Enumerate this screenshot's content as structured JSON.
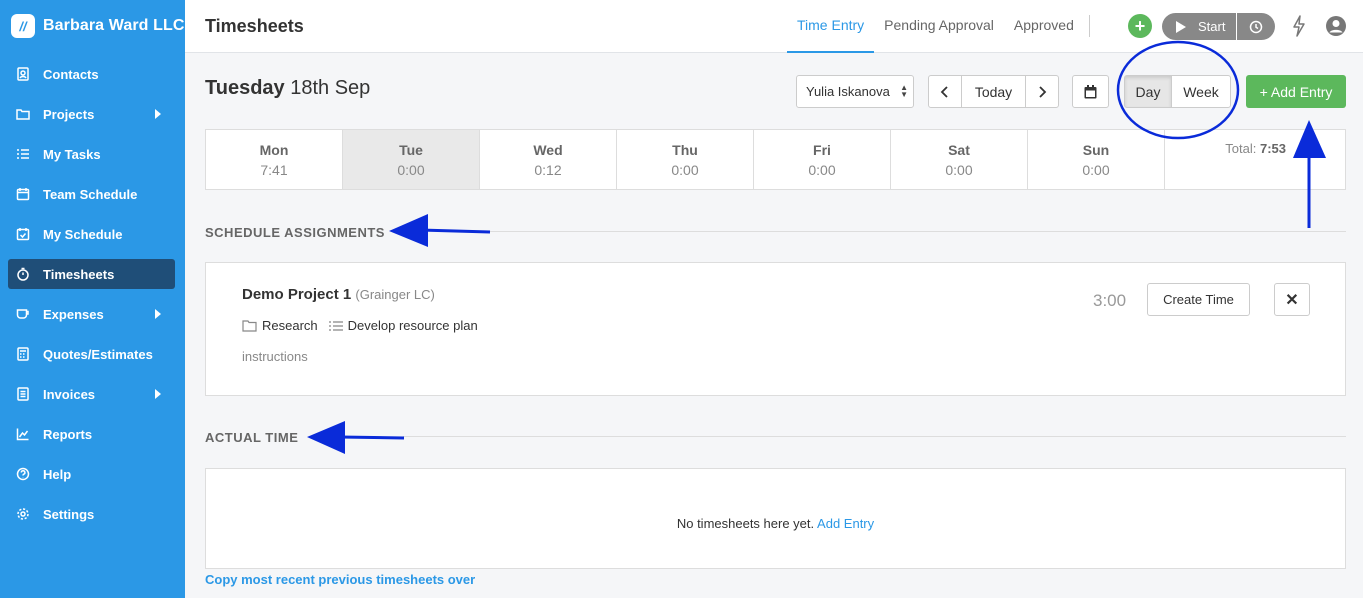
{
  "brand": {
    "name": "Barbara Ward LLC",
    "logo_glyph": "//"
  },
  "sidebar": {
    "items": [
      {
        "label": "Contacts",
        "icon": "contacts-icon"
      },
      {
        "label": "Projects",
        "icon": "folder-icon",
        "expandable": true
      },
      {
        "label": "My Tasks",
        "icon": "tasks-icon"
      },
      {
        "label": "Team Schedule",
        "icon": "calendar-icon"
      },
      {
        "label": "My Schedule",
        "icon": "calendar-check-icon"
      },
      {
        "label": "Timesheets",
        "icon": "stopwatch-icon",
        "active": true
      },
      {
        "label": "Expenses",
        "icon": "cup-icon",
        "expandable": true
      },
      {
        "label": "Quotes/Estimates",
        "icon": "calculator-icon"
      },
      {
        "label": "Invoices",
        "icon": "invoice-icon",
        "expandable": true
      },
      {
        "label": "Reports",
        "icon": "chart-icon"
      },
      {
        "label": "Help",
        "icon": "help-icon"
      },
      {
        "label": "Settings",
        "icon": "gear-icon"
      }
    ]
  },
  "header": {
    "title": "Timesheets",
    "tabs": [
      {
        "label": "Time Entry",
        "active": true
      },
      {
        "label": "Pending Approval"
      },
      {
        "label": "Approved"
      }
    ],
    "start_label": "Start",
    "plus_glyph": "+"
  },
  "toolbar": {
    "date_day": "Tuesday",
    "date_rest": "18th Sep",
    "user_select_value": "Yulia Iskanova",
    "today_label": "Today",
    "view_day_label": "Day",
    "view_week_label": "Week",
    "add_entry_label": "+ Add Entry"
  },
  "week": {
    "days": [
      {
        "name": "Mon",
        "time": "7:41"
      },
      {
        "name": "Tue",
        "time": "0:00",
        "selected": true
      },
      {
        "name": "Wed",
        "time": "0:12"
      },
      {
        "name": "Thu",
        "time": "0:00"
      },
      {
        "name": "Fri",
        "time": "0:00"
      },
      {
        "name": "Sat",
        "time": "0:00"
      },
      {
        "name": "Sun",
        "time": "0:00"
      }
    ],
    "total_label": "Total:",
    "total_value": "7:53"
  },
  "schedule": {
    "section_label": "SCHEDULE ASSIGNMENTS",
    "project_name": "Demo Project 1",
    "client": "(Grainger LC)",
    "category": "Research",
    "task": "Develop resource plan",
    "notes": "instructions",
    "hours": "3:00",
    "create_time_label": "Create Time",
    "close_glyph": "✕"
  },
  "actual": {
    "section_label": "ACTUAL TIME",
    "empty_text": "No timesheets here yet.",
    "add_entry_link": "Add Entry",
    "copy_link": "Copy most recent previous timesheets over"
  },
  "colors": {
    "sidebar_bg": "#2b98e6",
    "sidebar_active": "#1f4e78",
    "accent": "#2b98e6",
    "success": "#5cb85c",
    "annotation": "#0a2bd9"
  }
}
